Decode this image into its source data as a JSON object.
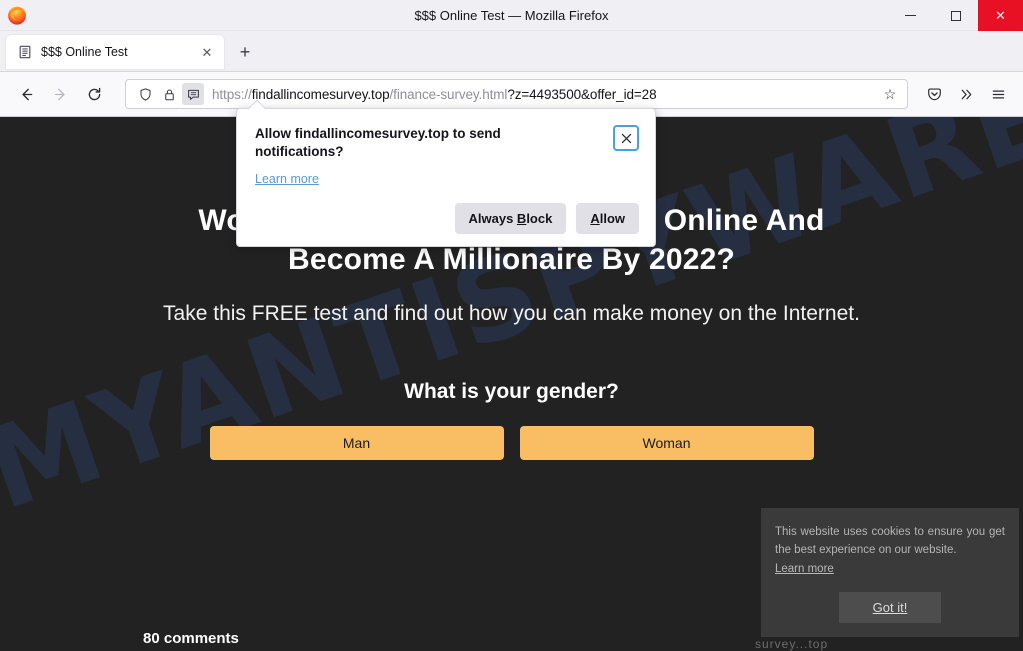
{
  "window": {
    "title": "$$$ Online Test — Mozilla Firefox",
    "minimize_label": "Minimize",
    "maximize_label": "Maximize",
    "close_label": "Close",
    "close_glyph": "✕",
    "logo_name": "firefox-logo"
  },
  "tabs": {
    "items": [
      {
        "title": "$$$ Online Test",
        "favicon": "page-icon",
        "close_glyph": "✕"
      }
    ],
    "new_tab_glyph": "+"
  },
  "toolbar": {
    "back_glyph": "←",
    "forward_glyph": "→",
    "reload_glyph": "⟳",
    "pocket_glyph": "⌄",
    "overflow_glyph": "»",
    "menu_glyph": "☰",
    "star_glyph": "☆"
  },
  "urlbar": {
    "scheme": "https://",
    "host": "findallincomesurvey.top",
    "path": "/finance-survey.html",
    "query": "?z=4493500&offer_id=28",
    "full_url": "https://findallincomesurvey.top/finance-survey.html?z=4493500&offer_id=28",
    "shield_icon": "shield-icon",
    "lock_icon": "lock-icon",
    "notification_icon": "notification-permission-icon"
  },
  "permission_popup": {
    "title": "Allow findallincomesurvey.top to send notifications?",
    "learn_more": "Learn more",
    "always_block_pre": "Always ",
    "always_block_key": "B",
    "always_block_post": "lock",
    "allow_key": "A",
    "allow_post": "llow",
    "close_glyph": "✕"
  },
  "page": {
    "watermark": "MYANTISPYWARE.COM",
    "headline_line1": "Would You Like To Make Money Online And",
    "headline_line2": "Become A Millionaire By 2022?",
    "subhead": "Take this FREE test and find out how you can make money on the Internet.",
    "question": "What is your gender?",
    "choices": [
      {
        "label": "Man"
      },
      {
        "label": "Woman"
      }
    ],
    "comments": "80 comments",
    "footer_ghost": "survey...top",
    "background_color": "#222222",
    "button_color": "#f9be64"
  },
  "cookie_notice": {
    "text": "This website uses cookies to ensure you get the best experience on our website.",
    "learn_more": "Learn more",
    "accept_label": "Got it!"
  }
}
